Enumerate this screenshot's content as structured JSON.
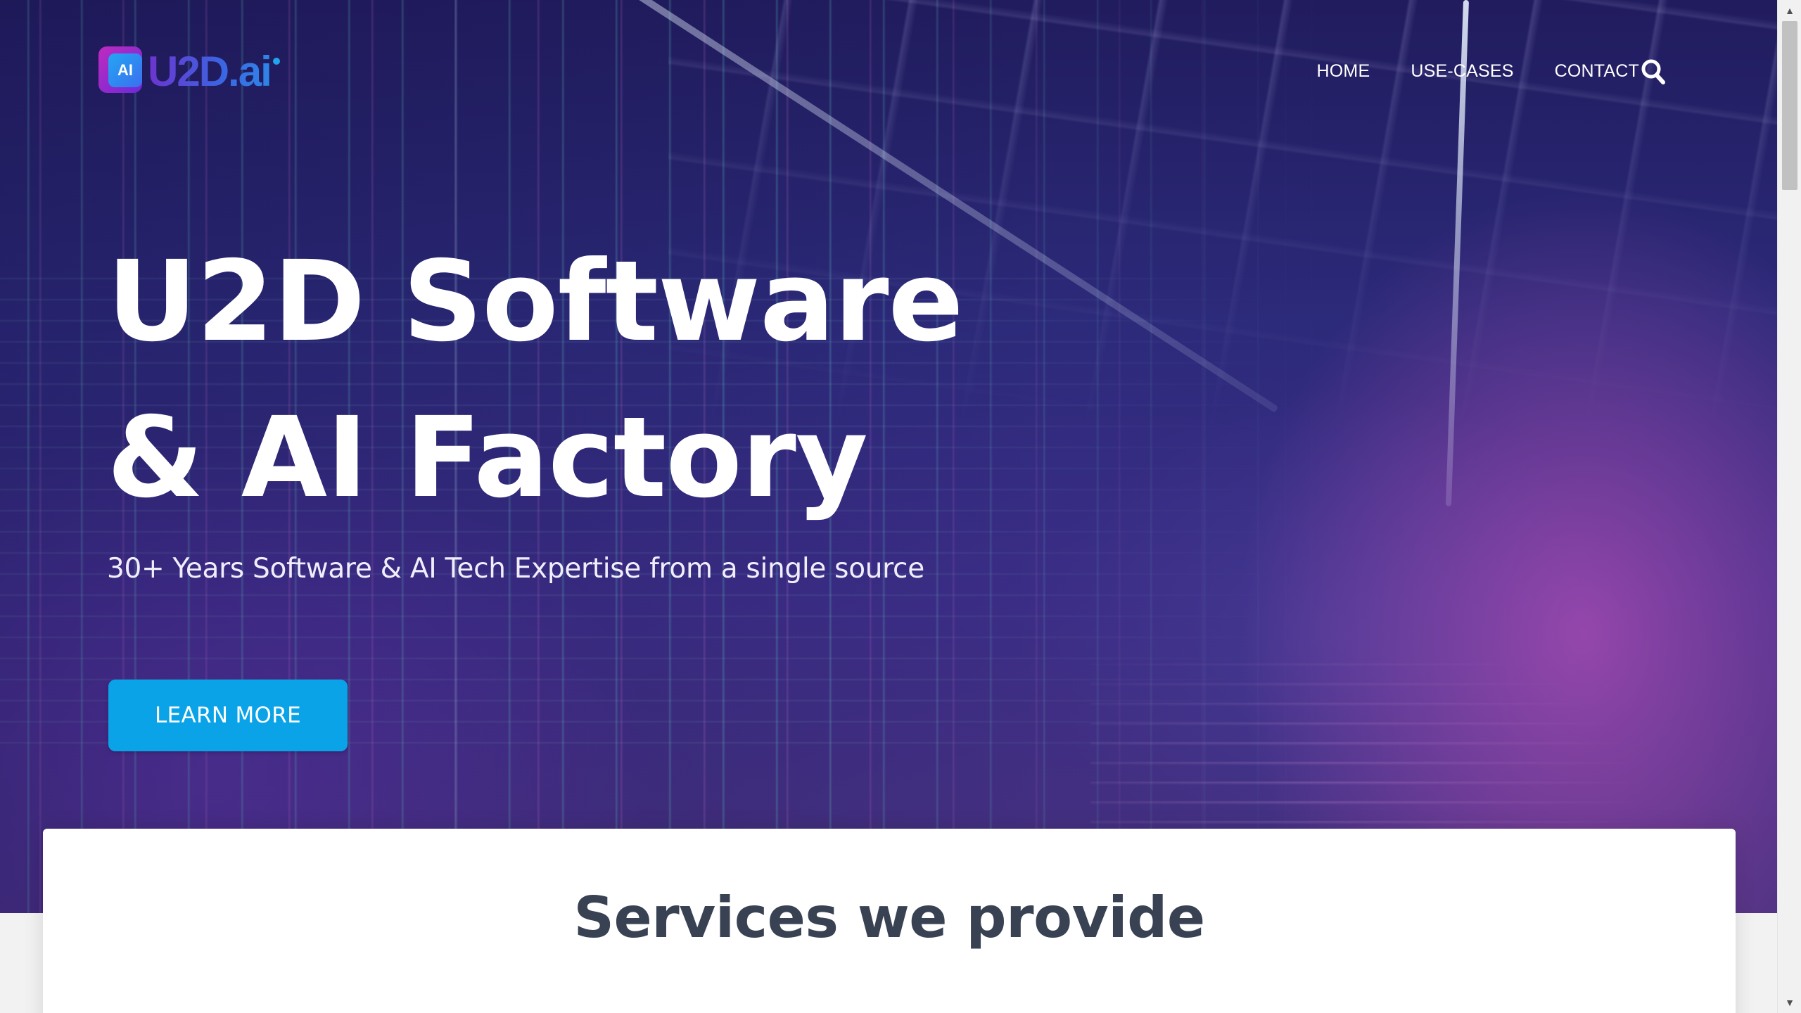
{
  "site": {
    "logo": {
      "mark_text": "AI",
      "wordmark": "U2D.ai"
    },
    "nav": {
      "items": [
        "HOME",
        "USE-CASES",
        "CONTACT"
      ],
      "search_icon": "search-icon"
    }
  },
  "hero": {
    "title_line_1": "U2D Software",
    "title_line_2": "& AI Factory",
    "subtitle": "30+ Years Software & AI Tech Expertise from a single source",
    "cta_label": "LEARN MORE"
  },
  "services": {
    "heading": "Services we provide"
  },
  "scrollbar": {
    "up_icon": "▲",
    "down_icon": "▼"
  },
  "colors": {
    "accent": "#0aa3e8",
    "heading_text": "#394253",
    "hero_bg": "#2c2a7a"
  }
}
